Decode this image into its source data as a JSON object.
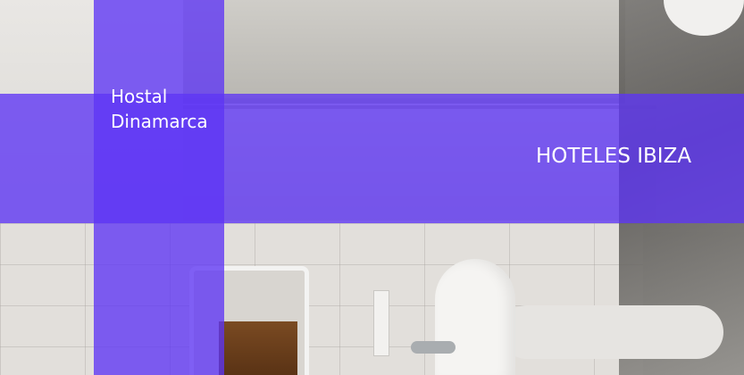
{
  "title": {
    "line1": "Hostal",
    "line2": "Dinamarca"
  },
  "category": "HOTELES IBIZA",
  "colors": {
    "overlay": "#5e34f5",
    "text": "#ffffff"
  }
}
